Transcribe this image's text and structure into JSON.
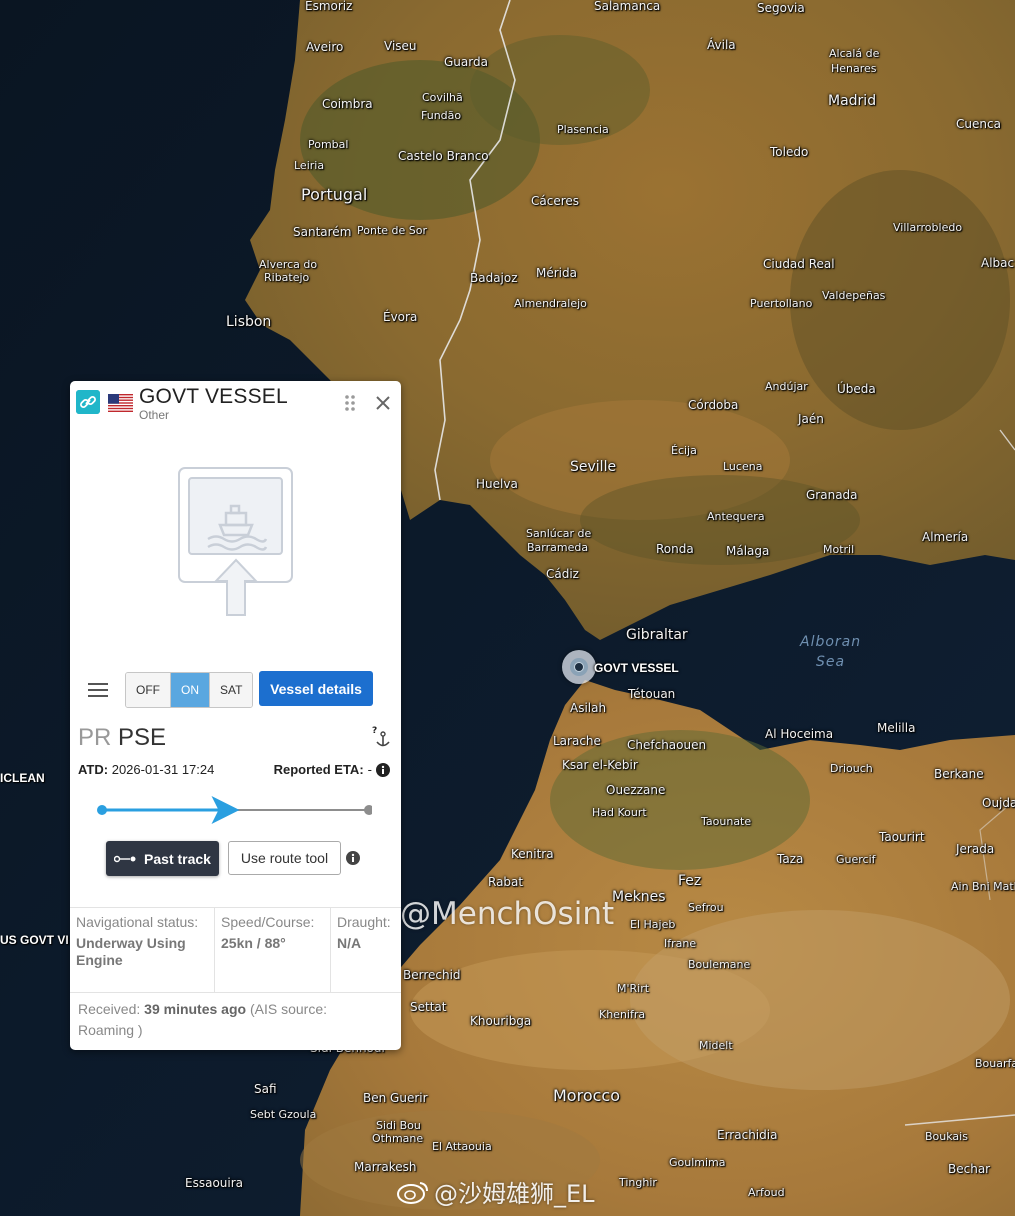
{
  "map": {
    "places": [
      {
        "name": "Esmoriz"
      },
      {
        "name": "Salamanca"
      },
      {
        "name": "Segovia"
      },
      {
        "name": "Aveiro"
      },
      {
        "name": "Viseu"
      },
      {
        "name": "Guarda"
      },
      {
        "name": "Ávila"
      },
      {
        "name": "Alcalá de"
      },
      {
        "name": "Henares"
      },
      {
        "name": "Madrid"
      },
      {
        "name": "Coimbra"
      },
      {
        "name": "Covilhã"
      },
      {
        "name": "Fundão"
      },
      {
        "name": "Plasencia"
      },
      {
        "name": "Cuenca"
      },
      {
        "name": "Pombal"
      },
      {
        "name": "Castelo Branco"
      },
      {
        "name": "Toledo"
      },
      {
        "name": "Leiria"
      },
      {
        "name": "Portugal"
      },
      {
        "name": "Cáceres"
      },
      {
        "name": "Santarém"
      },
      {
        "name": "Ponte de Sor"
      },
      {
        "name": "Villarrobledo"
      },
      {
        "name": "Alverca do"
      },
      {
        "name": "Ribatejo"
      },
      {
        "name": "Mérida"
      },
      {
        "name": "Badajoz"
      },
      {
        "name": "Ciudad Real"
      },
      {
        "name": "Albac"
      },
      {
        "name": "Almendralejo"
      },
      {
        "name": "Puertollano"
      },
      {
        "name": "Valdepeñas"
      },
      {
        "name": "Lisbon"
      },
      {
        "name": "Évora"
      },
      {
        "name": "Andújar"
      },
      {
        "name": "Úbeda"
      },
      {
        "name": "Córdoba"
      },
      {
        "name": "Jaén"
      },
      {
        "name": "Écija"
      },
      {
        "name": "Seville"
      },
      {
        "name": "Lucena"
      },
      {
        "name": "Huelva"
      },
      {
        "name": "Granada"
      },
      {
        "name": "Antequera"
      },
      {
        "name": "Sanlúcar de"
      },
      {
        "name": "Barrameda"
      },
      {
        "name": "Ronda"
      },
      {
        "name": "Málaga"
      },
      {
        "name": "Motril"
      },
      {
        "name": "Almería"
      },
      {
        "name": "Cádiz"
      },
      {
        "name": "Gibraltar"
      },
      {
        "name": "Tétouan"
      },
      {
        "name": "Asilah"
      },
      {
        "name": "Al Hoceima"
      },
      {
        "name": "Melilla"
      },
      {
        "name": "Larache"
      },
      {
        "name": "Chefchaouen"
      },
      {
        "name": "Ksar el-Kebir"
      },
      {
        "name": "Driouch"
      },
      {
        "name": "Berkane"
      },
      {
        "name": "Oujda"
      },
      {
        "name": "Ouezzane"
      },
      {
        "name": "Had Kourt"
      },
      {
        "name": "Taounate"
      },
      {
        "name": "Taourirt"
      },
      {
        "name": "Kenitra"
      },
      {
        "name": "Taza"
      },
      {
        "name": "Guercif"
      },
      {
        "name": "Jerada"
      },
      {
        "name": "Rabat"
      },
      {
        "name": "Fez"
      },
      {
        "name": "Ain Bni Mathar"
      },
      {
        "name": "Meknes"
      },
      {
        "name": "Sefrou"
      },
      {
        "name": "El Hajeb"
      },
      {
        "name": "Ifrane"
      },
      {
        "name": "Boulemane"
      },
      {
        "name": "Berrechid"
      },
      {
        "name": "M'Rirt"
      },
      {
        "name": "Settat"
      },
      {
        "name": "Khenifra"
      },
      {
        "name": "Khouribga"
      },
      {
        "name": "Midelt"
      },
      {
        "name": "Bouarfa"
      },
      {
        "name": "Safi"
      },
      {
        "name": "Ben Guerir"
      },
      {
        "name": "Morocco"
      },
      {
        "name": "Sebt Gzoula"
      },
      {
        "name": "Sidi Bou"
      },
      {
        "name": "Othmane"
      },
      {
        "name": "El Attaouia"
      },
      {
        "name": "Errachidia"
      },
      {
        "name": "Boukais"
      },
      {
        "name": "Marrakesh"
      },
      {
        "name": "Goulmima"
      },
      {
        "name": "Bechar"
      },
      {
        "name": "Essaouira"
      },
      {
        "name": "Tinghir"
      },
      {
        "name": "Arfoud"
      },
      {
        "name": "Sidi Bennour"
      }
    ],
    "sea_name_line1": "Alboran",
    "sea_name_line2": "Sea",
    "edge_label_1": "ICLEAN",
    "edge_label_2": "US GOVT VI",
    "marker_label": "GOVT VESSEL"
  },
  "watermarks": {
    "osint": "@MenchOsint",
    "weibo": "@沙姆雄狮_EL"
  },
  "panel": {
    "title": "GOVT VESSEL",
    "subtitle": "Other",
    "flag": "us-flag-icon",
    "toggle": {
      "options": [
        "OFF",
        "ON",
        "SAT"
      ],
      "selected": "ON"
    },
    "details_button": "Vessel details",
    "port_prefix": "PR",
    "port_name": "PSE",
    "atd_label": "ATD:",
    "atd_value": "2026-01-31 17:24",
    "eta_label": "Reported ETA:",
    "eta_value": "-",
    "voyage_progress_fraction": 0.5,
    "past_track_button": "Past track",
    "route_tool_button": "Use route tool",
    "nav_status_label": "Navigational status:",
    "nav_status_value": "Underway Using Engine",
    "speed_label": "Speed/Course:",
    "speed_value": "25kn / 88°",
    "draught_label": "Draught:",
    "draught_value": "N/A",
    "received_prefix": "Received:",
    "received_value": "39 minutes ago",
    "received_suffix": "(AIS source: Roaming )"
  },
  "colors": {
    "accent_blue": "#1c6fcf",
    "toggle_active": "#5aa7e0",
    "progress_arrow": "#2a9fe0",
    "link_teal": "#20b6c9"
  }
}
